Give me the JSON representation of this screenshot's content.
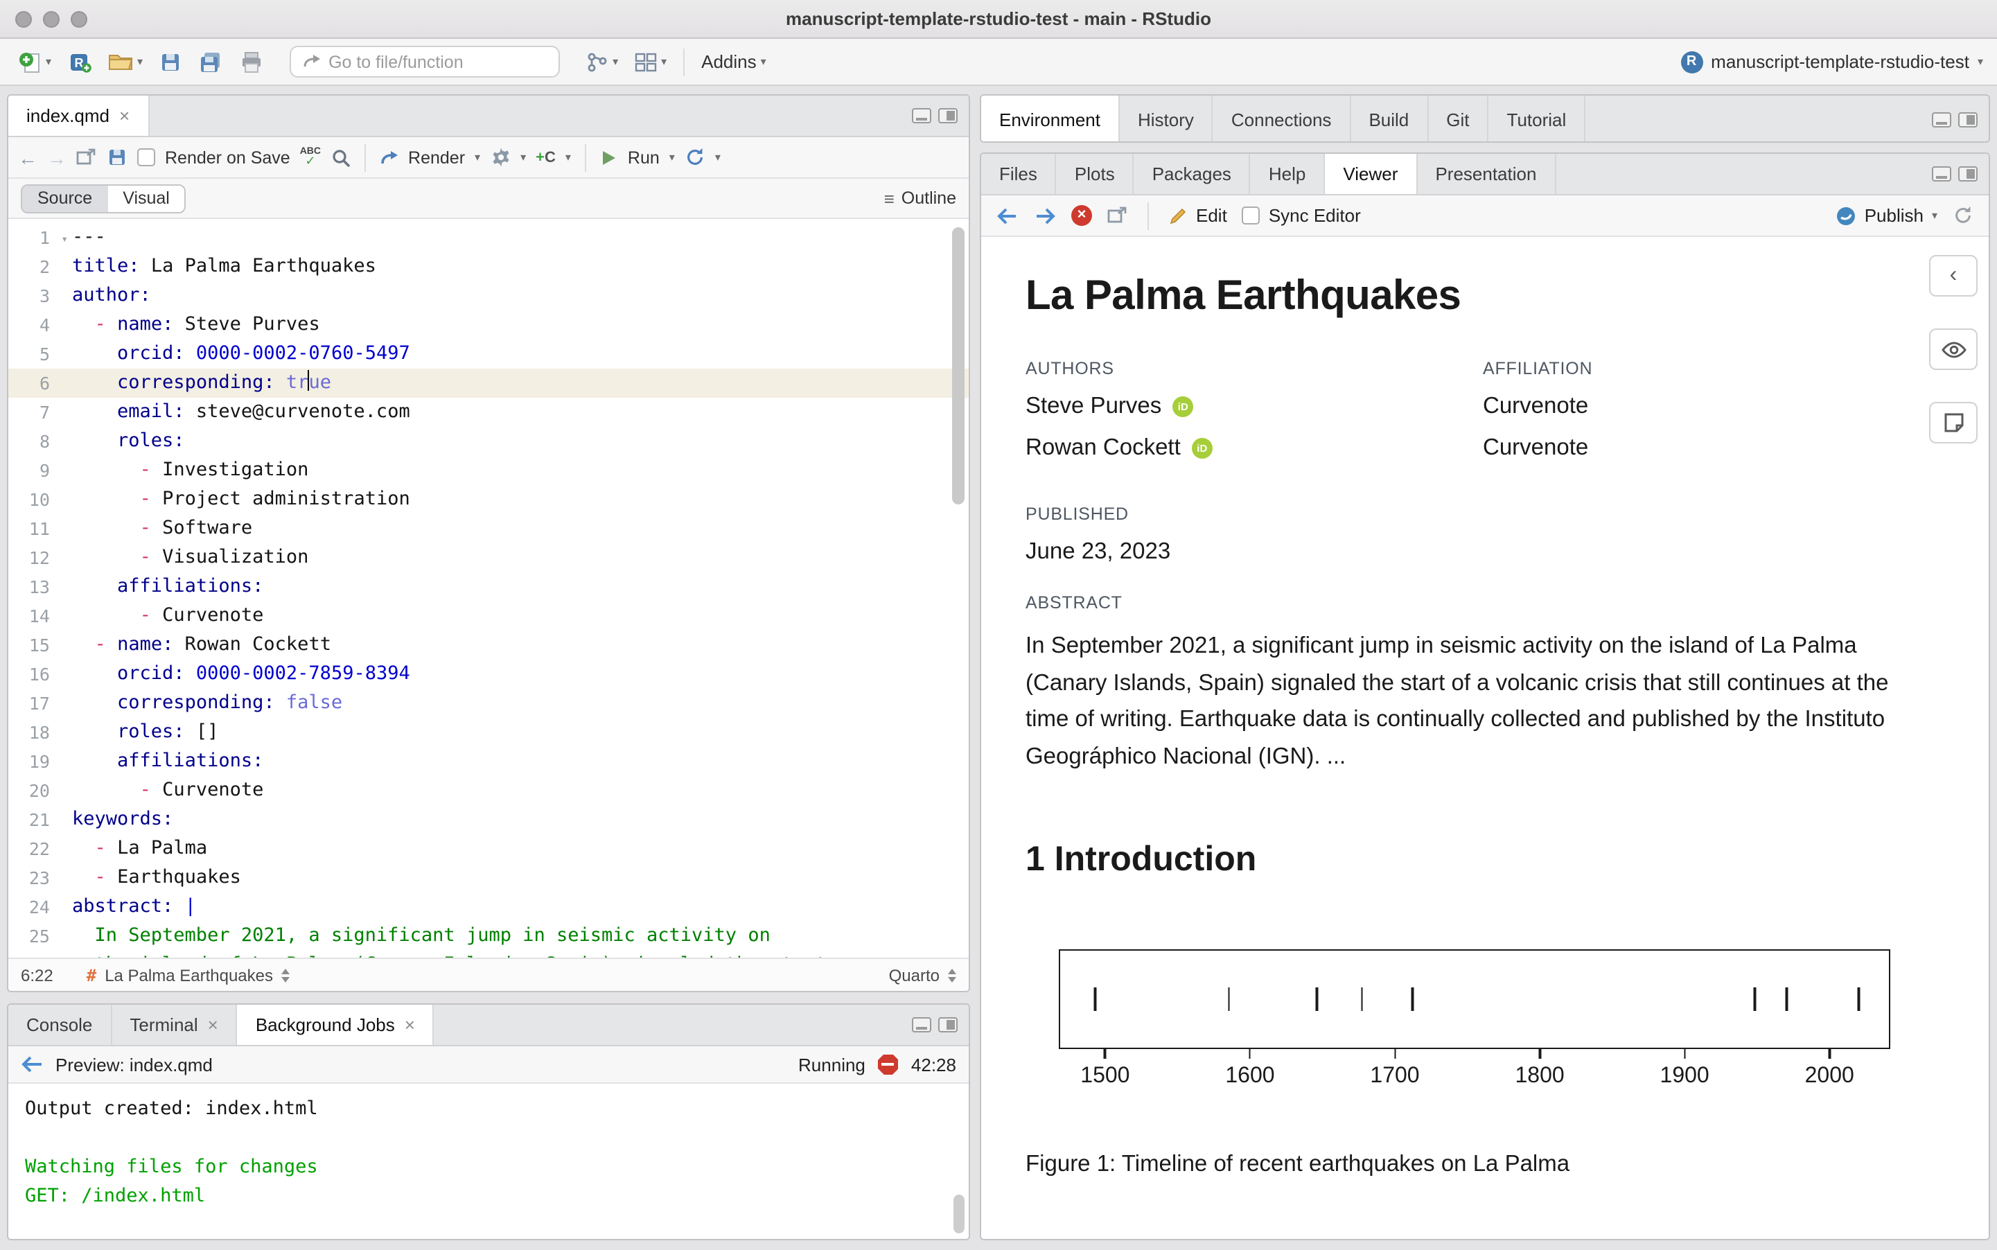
{
  "window": {
    "title": "manuscript-template-rstudio-test - main - RStudio"
  },
  "main_toolbar": {
    "goto_placeholder": "Go to file/function",
    "addins_label": "Addins",
    "project_label": "manuscript-template-rstudio-test"
  },
  "source_pane": {
    "tab_label": "index.qmd",
    "toolbar": {
      "render_on_save": "Render on Save",
      "render": "Render",
      "run": "Run"
    },
    "view_toggle": {
      "source": "Source",
      "visual": "Visual",
      "outline": "Outline"
    },
    "status": {
      "position": "6:22",
      "section": "La Palma Earthquakes",
      "mode": "Quarto"
    },
    "code_lines": [
      {
        "n": 1,
        "fold": true,
        "segs": [
          [
            "---",
            "plain"
          ]
        ]
      },
      {
        "n": 2,
        "segs": [
          [
            "title:",
            "key"
          ],
          [
            " La Palma Earthquakes",
            "plain"
          ]
        ]
      },
      {
        "n": 3,
        "segs": [
          [
            "author:",
            "key"
          ]
        ]
      },
      {
        "n": 4,
        "segs": [
          [
            "  ",
            "plain"
          ],
          [
            "-",
            "dash"
          ],
          [
            " ",
            "plain"
          ],
          [
            "name:",
            "key"
          ],
          [
            " Steve Purves",
            "plain"
          ]
        ]
      },
      {
        "n": 5,
        "segs": [
          [
            "    ",
            "plain"
          ],
          [
            "orcid:",
            "key"
          ],
          [
            " ",
            "plain"
          ],
          [
            "0000-0002-0760-5497",
            "num"
          ]
        ]
      },
      {
        "n": 6,
        "hl": true,
        "segs": [
          [
            "    ",
            "plain"
          ],
          [
            "corresponding:",
            "key"
          ],
          [
            " ",
            "plain"
          ],
          [
            "tr",
            "bool"
          ],
          [
            "",
            "caret"
          ],
          [
            "ue",
            "bool"
          ]
        ]
      },
      {
        "n": 7,
        "segs": [
          [
            "    ",
            "plain"
          ],
          [
            "email:",
            "key"
          ],
          [
            " steve@curvenote.com",
            "plain"
          ]
        ]
      },
      {
        "n": 8,
        "segs": [
          [
            "    ",
            "plain"
          ],
          [
            "roles:",
            "key"
          ]
        ]
      },
      {
        "n": 9,
        "segs": [
          [
            "      ",
            "plain"
          ],
          [
            "-",
            "dash"
          ],
          [
            " Investigation",
            "plain"
          ]
        ]
      },
      {
        "n": 10,
        "segs": [
          [
            "      ",
            "plain"
          ],
          [
            "-",
            "dash"
          ],
          [
            " Project administration",
            "plain"
          ]
        ]
      },
      {
        "n": 11,
        "segs": [
          [
            "      ",
            "plain"
          ],
          [
            "-",
            "dash"
          ],
          [
            " Software",
            "plain"
          ]
        ]
      },
      {
        "n": 12,
        "segs": [
          [
            "      ",
            "plain"
          ],
          [
            "-",
            "dash"
          ],
          [
            " Visualization",
            "plain"
          ]
        ]
      },
      {
        "n": 13,
        "segs": [
          [
            "    ",
            "plain"
          ],
          [
            "affiliations:",
            "key"
          ]
        ]
      },
      {
        "n": 14,
        "segs": [
          [
            "      ",
            "plain"
          ],
          [
            "-",
            "dash"
          ],
          [
            " Curvenote",
            "plain"
          ]
        ]
      },
      {
        "n": 15,
        "segs": [
          [
            "  ",
            "plain"
          ],
          [
            "-",
            "dash"
          ],
          [
            " ",
            "plain"
          ],
          [
            "name:",
            "key"
          ],
          [
            " Rowan Cockett",
            "plain"
          ]
        ]
      },
      {
        "n": 16,
        "segs": [
          [
            "    ",
            "plain"
          ],
          [
            "orcid:",
            "key"
          ],
          [
            " ",
            "plain"
          ],
          [
            "0000-0002-7859-8394",
            "num"
          ]
        ]
      },
      {
        "n": 17,
        "segs": [
          [
            "    ",
            "plain"
          ],
          [
            "corresponding:",
            "key"
          ],
          [
            " ",
            "plain"
          ],
          [
            "false",
            "bool"
          ]
        ]
      },
      {
        "n": 18,
        "segs": [
          [
            "    ",
            "plain"
          ],
          [
            "roles:",
            "key"
          ],
          [
            " []",
            "plain"
          ]
        ]
      },
      {
        "n": 19,
        "segs": [
          [
            "    ",
            "plain"
          ],
          [
            "affiliations:",
            "key"
          ]
        ]
      },
      {
        "n": 20,
        "segs": [
          [
            "      ",
            "plain"
          ],
          [
            "-",
            "dash"
          ],
          [
            " Curvenote",
            "plain"
          ]
        ]
      },
      {
        "n": 21,
        "segs": [
          [
            "keywords:",
            "key"
          ]
        ]
      },
      {
        "n": 22,
        "segs": [
          [
            "  ",
            "plain"
          ],
          [
            "-",
            "dash"
          ],
          [
            " La Palma",
            "plain"
          ]
        ]
      },
      {
        "n": 23,
        "segs": [
          [
            "  ",
            "plain"
          ],
          [
            "-",
            "dash"
          ],
          [
            " Earthquakes",
            "plain"
          ]
        ]
      },
      {
        "n": 24,
        "segs": [
          [
            "abstract:",
            "key"
          ],
          [
            " ",
            "plain"
          ],
          [
            "|",
            "num"
          ]
        ]
      },
      {
        "n": 25,
        "segs": [
          [
            "  In September 2021, a significant jump in seismic activity on",
            "str"
          ]
        ]
      },
      {
        "n": 26,
        "segs": [
          [
            "  the island of La Palma (Canary Islands, Spain) signaled the start",
            "str"
          ]
        ]
      }
    ]
  },
  "console_pane": {
    "tabs": [
      {
        "label": "Console"
      },
      {
        "label": "Terminal",
        "closable": true
      },
      {
        "label": "Background Jobs",
        "closable": true,
        "active": true
      }
    ],
    "toolbar": {
      "title": "Preview: index.qmd",
      "status": "Running",
      "elapsed": "42:28"
    },
    "lines": [
      {
        "text": "Output created: index.html",
        "cls": "plain"
      },
      {
        "text": "",
        "cls": "plain"
      },
      {
        "text": "Watching files for changes",
        "cls": "green"
      },
      {
        "text": "GET: /index.html",
        "cls": "green"
      }
    ]
  },
  "right_top": {
    "tabs": [
      {
        "label": "Environment",
        "active": true
      },
      {
        "label": "History"
      },
      {
        "label": "Connections"
      },
      {
        "label": "Build"
      },
      {
        "label": "Git"
      },
      {
        "label": "Tutorial"
      }
    ]
  },
  "viewer_pane": {
    "tabs": [
      {
        "label": "Files"
      },
      {
        "label": "Plots"
      },
      {
        "label": "Packages"
      },
      {
        "label": "Help"
      },
      {
        "label": "Viewer",
        "active": true
      },
      {
        "label": "Presentation"
      }
    ],
    "toolbar": {
      "edit": "Edit",
      "sync": "Sync Editor",
      "publish": "Publish"
    }
  },
  "document": {
    "title": "La Palma Earthquakes",
    "authors_label": "AUTHORS",
    "affiliation_label": "AFFILIATION",
    "authors": [
      {
        "name": "Steve Purves",
        "affiliation": "Curvenote"
      },
      {
        "name": "Rowan Cockett",
        "affiliation": "Curvenote"
      }
    ],
    "published_label": "PUBLISHED",
    "published_date": "June 23, 2023",
    "abstract_label": "ABSTRACT",
    "abstract": "In September 2021, a significant jump in seismic activity on the island of La Palma (Canary Islands, Spain) signaled the start of a volcanic crisis that still continues at the time of writing. Earthquake data is continually collected and published by the Instituto Geográphico Nacional (IGN). ...",
    "section_heading": "1 Introduction",
    "figure_caption": "Figure 1: Timeline of recent earthquakes on La Palma"
  },
  "chart_data": {
    "type": "scatter",
    "title": "Timeline of recent earthquakes on La Palma",
    "x_values": [
      1492,
      1585,
      1646,
      1677,
      1712,
      1949,
      1971,
      2021
    ],
    "x_ticks": [
      1500,
      1600,
      1700,
      1800,
      1900,
      2000
    ],
    "xlim": [
      1468,
      2042
    ],
    "xlabel": "",
    "ylabel": "",
    "legend": false
  },
  "colors": {
    "accent_blue": "#4c8dd2",
    "console_green": "#00a000",
    "orcid_green": "#a6ce39",
    "stop_red": "#cf3a2e"
  }
}
